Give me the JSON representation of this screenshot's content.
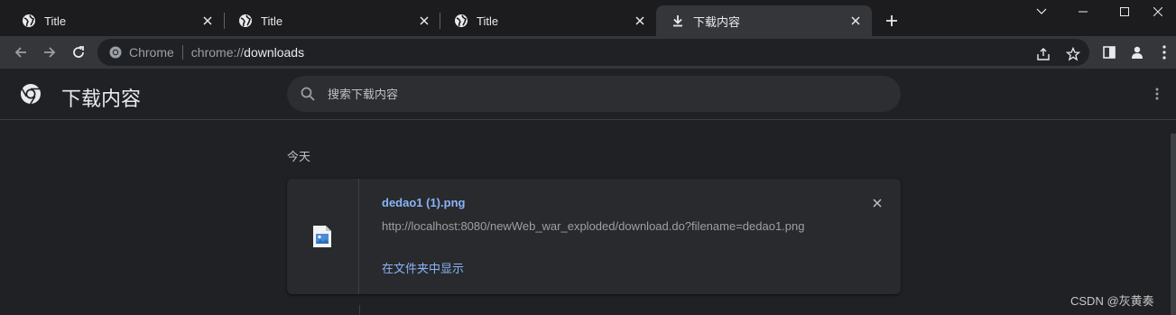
{
  "tabs": [
    {
      "label": "Title",
      "icon": "globe-icon",
      "active": false
    },
    {
      "label": "Title",
      "icon": "globe-icon",
      "active": false
    },
    {
      "label": "Title",
      "icon": "globe-icon",
      "active": false
    },
    {
      "label": "下载内容",
      "icon": "download-icon",
      "active": true
    }
  ],
  "omnibox": {
    "chip": "Chrome",
    "scheme": "chrome://",
    "host": "downloads"
  },
  "header": {
    "title": "下载内容",
    "search_placeholder": "搜索下载内容"
  },
  "downloads": {
    "date_heading": "今天",
    "items": [
      {
        "file_name": "dedao1 (1).png",
        "url": "http://localhost:8080/newWeb_war_exploded/download.do?filename=dedao1.png",
        "action": "在文件夹中显示"
      }
    ]
  },
  "watermark": "CSDN @灰黄奏",
  "colors": {
    "accent": "#8ab4f8",
    "background": "#202124",
    "card": "#292a2d",
    "toolbar": "#35363a"
  }
}
